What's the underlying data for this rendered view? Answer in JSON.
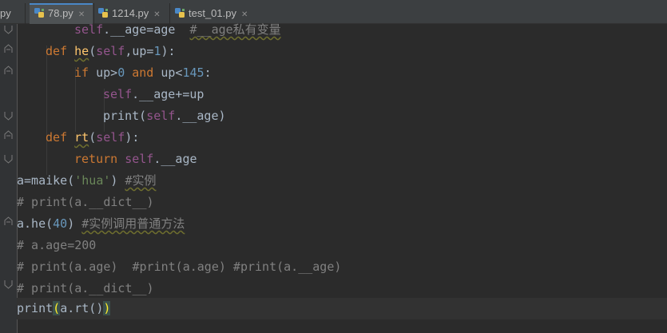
{
  "tabs": [
    {
      "label": "py",
      "active": false
    },
    {
      "label": "78.py",
      "active": true
    },
    {
      "label": "1214.py",
      "active": false
    },
    {
      "label": "test_01.py",
      "active": false
    }
  ],
  "code": {
    "l1": {
      "a": "self",
      "b": ".__age=age  ",
      "c": "#__age私有变量"
    },
    "l2": {
      "kw": "def ",
      "fn": "he",
      "p1": "(",
      "self": "self",
      "p2": ",up=",
      "num": "1",
      "p3": "):"
    },
    "l3": {
      "kw": "if ",
      "t1": "up>",
      "n1": "0",
      "kw2": " and ",
      "t2": "up<",
      "n2": "145",
      "t3": ":"
    },
    "l4": {
      "self": "self",
      "t": ".__age+=up"
    },
    "l5": {
      "t1": "print(",
      "self": "self",
      "t2": ".__age)"
    },
    "l6": {
      "kw": "def ",
      "fn": "rt",
      "p1": "(",
      "self": "self",
      "p2": "):"
    },
    "l7": {
      "kw": "return ",
      "self": "self",
      "t": ".__age"
    },
    "l8": {
      "t1": "a=maike(",
      "str": "'hua'",
      "t2": ") ",
      "cmt": "#实例"
    },
    "l9": {
      "cmt": "# print(a.__dict__)"
    },
    "l10": {
      "t1": "a.he(",
      "num": "40",
      "t2": ") ",
      "cmt": "#实例调用普通方法"
    },
    "l11": {
      "cmt": "# a.age=200"
    },
    "l12": {
      "cmt": "# print(a.age)  #print(a.age) #print(a.__age)"
    },
    "l13": {
      "cmt": "# print(a.__dict__)"
    },
    "l14": {
      "t1": "print",
      "b1": "(",
      "t2": "a.rt()",
      "b2": ")"
    }
  },
  "colors": {
    "background": "#2b2b2b",
    "keyword": "#cc7832",
    "self": "#94558d",
    "number": "#6897bb",
    "string": "#6a8759",
    "comment": "#808080",
    "function": "#ffc66d",
    "text": "#a9b7c6",
    "tab_active_accent": "#4a88c7"
  }
}
